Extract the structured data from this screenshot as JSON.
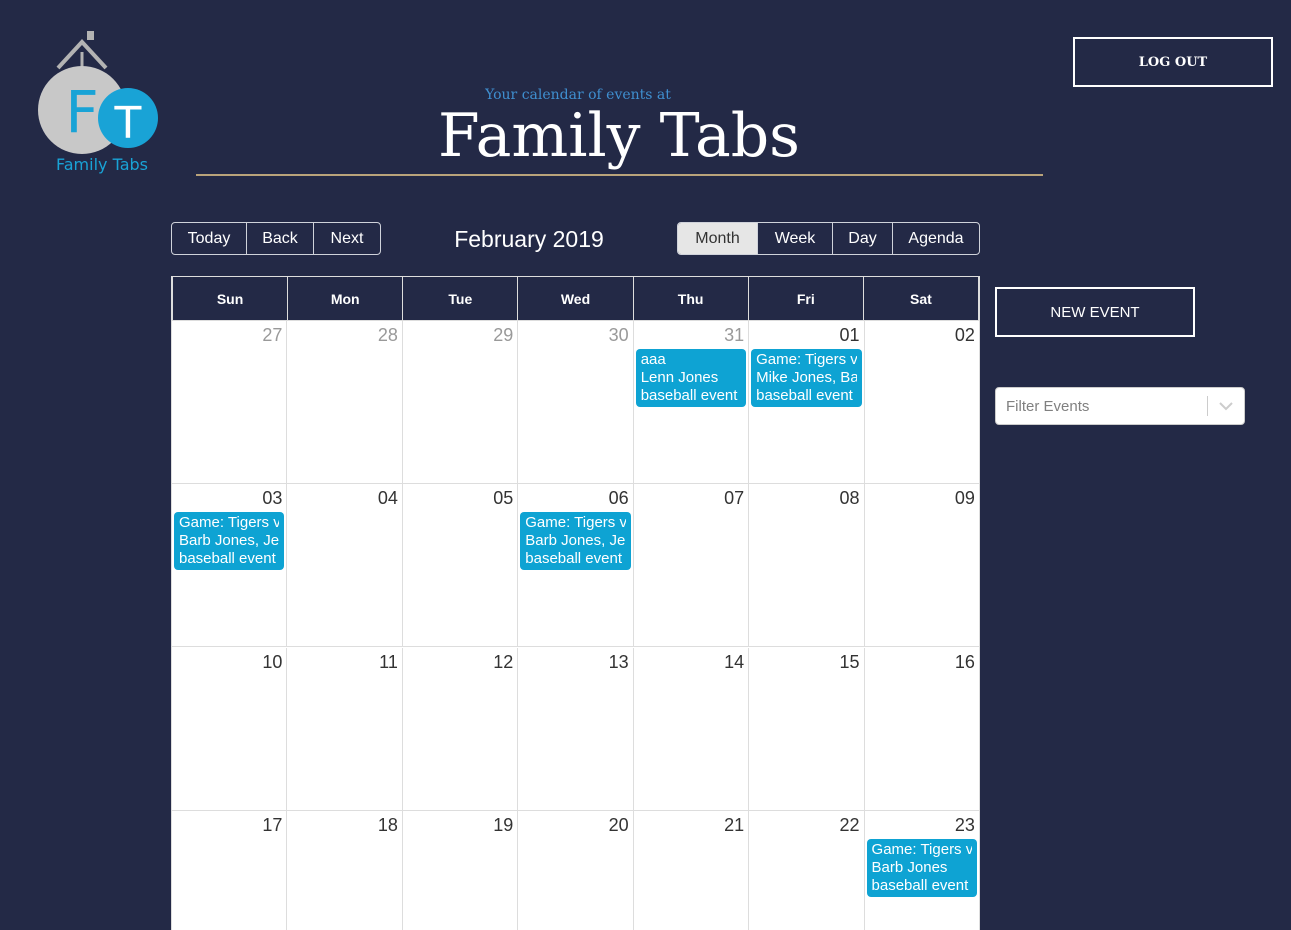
{
  "app": {
    "logo_text": "Family Tabs",
    "logo_letters": [
      "F",
      "T"
    ]
  },
  "header": {
    "subtitle": "Your calendar of events at",
    "title": "Family Tabs",
    "logout_label": "LOG OUT"
  },
  "toolbar": {
    "nav": [
      "Today",
      "Back",
      "Next"
    ],
    "month_label": "February 2019",
    "views": [
      "Month",
      "Week",
      "Day",
      "Agenda"
    ],
    "active_view": "Month"
  },
  "calendar": {
    "weekdays": [
      "Sun",
      "Mon",
      "Tue",
      "Wed",
      "Thu",
      "Fri",
      "Sat"
    ],
    "weeks": [
      [
        {
          "num": "27",
          "off": true
        },
        {
          "num": "28",
          "off": true
        },
        {
          "num": "29",
          "off": true
        },
        {
          "num": "30",
          "off": true
        },
        {
          "num": "31",
          "off": true,
          "event": [
            "aaa",
            "Lenn Jones",
            "baseball event"
          ]
        },
        {
          "num": "01",
          "event": [
            "Game: Tigers vs",
            "Mike Jones, Ba",
            "baseball event"
          ]
        },
        {
          "num": "02"
        }
      ],
      [
        {
          "num": "03",
          "event": [
            "Game: Tigers vs",
            "Barb Jones, Jen",
            "baseball event"
          ]
        },
        {
          "num": "04"
        },
        {
          "num": "05"
        },
        {
          "num": "06",
          "event": [
            "Game: Tigers vs",
            "Barb Jones, Jen",
            "baseball event"
          ]
        },
        {
          "num": "07"
        },
        {
          "num": "08"
        },
        {
          "num": "09"
        }
      ],
      [
        {
          "num": "10"
        },
        {
          "num": "11"
        },
        {
          "num": "12"
        },
        {
          "num": "13"
        },
        {
          "num": "14"
        },
        {
          "num": "15"
        },
        {
          "num": "16"
        }
      ],
      [
        {
          "num": "17"
        },
        {
          "num": "18"
        },
        {
          "num": "19"
        },
        {
          "num": "20"
        },
        {
          "num": "21"
        },
        {
          "num": "22"
        },
        {
          "num": "23",
          "event": [
            "Game: Tigers vs",
            "Barb Jones",
            "baseball event"
          ]
        }
      ]
    ]
  },
  "sidebar": {
    "new_event_label": "NEW EVENT",
    "filter_placeholder": "Filter Events"
  },
  "colors": {
    "background": "#232946",
    "event": "#0ea3d3",
    "accent_rule": "#b9a37a"
  }
}
